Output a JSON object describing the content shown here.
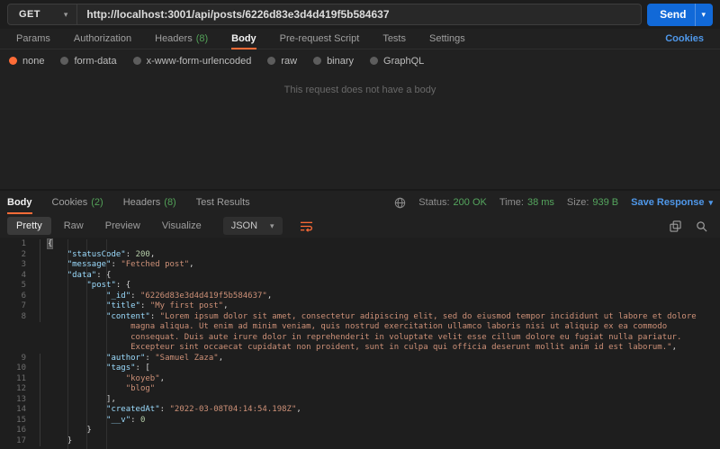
{
  "request": {
    "method": "GET",
    "url": "http://localhost:3001/api/posts/6226d83e3d4d419f5b584637",
    "send_label": "Send",
    "cookies_link": "Cookies",
    "tabs": [
      {
        "label": "Params"
      },
      {
        "label": "Authorization"
      },
      {
        "label": "Headers",
        "count": "(8)"
      },
      {
        "label": "Body",
        "active": true
      },
      {
        "label": "Pre-request Script"
      },
      {
        "label": "Tests"
      },
      {
        "label": "Settings"
      }
    ],
    "body_modes": [
      {
        "label": "none",
        "selected": true
      },
      {
        "label": "form-data"
      },
      {
        "label": "x-www-form-urlencoded"
      },
      {
        "label": "raw"
      },
      {
        "label": "binary"
      },
      {
        "label": "GraphQL"
      }
    ],
    "empty_body_message": "This request does not have a body"
  },
  "response": {
    "tabs": [
      {
        "label": "Body",
        "active": true
      },
      {
        "label": "Cookies",
        "count": "(2)"
      },
      {
        "label": "Headers",
        "count": "(8)"
      },
      {
        "label": "Test Results"
      }
    ],
    "meta": {
      "status_label": "Status:",
      "status_value": "200 OK",
      "time_label": "Time:",
      "time_value": "38 ms",
      "size_label": "Size:",
      "size_value": "939 B",
      "save_label": "Save Response"
    },
    "view_tabs": [
      {
        "label": "Pretty",
        "active": true
      },
      {
        "label": "Raw"
      },
      {
        "label": "Preview"
      },
      {
        "label": "Visualize"
      }
    ],
    "format": "JSON"
  },
  "colors": {
    "accent_orange": "#ff6c37",
    "send_blue": "#1169d8",
    "link_blue": "#4f98ea",
    "status_green": "#55a65e",
    "code_key": "#9cdcfe",
    "code_string": "#ce9178",
    "code_number": "#b5cea8"
  },
  "code": {
    "lines": [
      {
        "num": 1,
        "indent": 0,
        "segments": [
          {
            "type": "punct",
            "text": "{",
            "highlight": true
          }
        ]
      },
      {
        "num": 2,
        "indent": 1,
        "segments": [
          {
            "type": "key",
            "text": "\"statusCode\""
          },
          {
            "type": "punct",
            "text": ": "
          },
          {
            "type": "number",
            "text": "200"
          },
          {
            "type": "punct",
            "text": ","
          }
        ]
      },
      {
        "num": 3,
        "indent": 1,
        "segments": [
          {
            "type": "key",
            "text": "\"message\""
          },
          {
            "type": "punct",
            "text": ": "
          },
          {
            "type": "string",
            "text": "\"Fetched post\""
          },
          {
            "type": "punct",
            "text": ","
          }
        ]
      },
      {
        "num": 4,
        "indent": 1,
        "segments": [
          {
            "type": "key",
            "text": "\"data\""
          },
          {
            "type": "punct",
            "text": ": {"
          }
        ]
      },
      {
        "num": 5,
        "indent": 2,
        "segments": [
          {
            "type": "key",
            "text": "\"post\""
          },
          {
            "type": "punct",
            "text": ": {"
          }
        ]
      },
      {
        "num": 6,
        "indent": 3,
        "segments": [
          {
            "type": "key",
            "text": "\"_id\""
          },
          {
            "type": "punct",
            "text": ": "
          },
          {
            "type": "string",
            "text": "\"6226d83e3d4d419f5b584637\""
          },
          {
            "type": "punct",
            "text": ","
          }
        ]
      },
      {
        "num": 7,
        "indent": 3,
        "segments": [
          {
            "type": "key",
            "text": "\"title\""
          },
          {
            "type": "punct",
            "text": ": "
          },
          {
            "type": "string",
            "text": "\"My first post\""
          },
          {
            "type": "punct",
            "text": ","
          }
        ]
      },
      {
        "num": 8,
        "indent": 3,
        "segments": [
          {
            "type": "key",
            "text": "\"content\""
          },
          {
            "type": "punct",
            "text": ": "
          },
          {
            "type": "string",
            "text": "\"Lorem ipsum dolor sit amet, consectetur adipiscing elit, sed do eiusmod tempor incididunt ut labore et dolore magna aliqua. Ut enim ad minim veniam, quis nostrud exercitation ullamco laboris nisi ut aliquip ex ea commodo consequat. Duis aute irure dolor in reprehenderit in voluptate velit esse cillum dolore eu fugiat nulla pariatur. Excepteur sint occaecat cupidatat non proident, sunt in culpa qui officia deserunt mollit anim id est laborum.\""
          },
          {
            "type": "punct",
            "text": ","
          }
        ]
      },
      {
        "num": 9,
        "indent": 3,
        "segments": [
          {
            "type": "key",
            "text": "\"author\""
          },
          {
            "type": "punct",
            "text": ": "
          },
          {
            "type": "string",
            "text": "\"Samuel Zaza\""
          },
          {
            "type": "punct",
            "text": ","
          }
        ]
      },
      {
        "num": 10,
        "indent": 3,
        "segments": [
          {
            "type": "key",
            "text": "\"tags\""
          },
          {
            "type": "punct",
            "text": ": ["
          }
        ]
      },
      {
        "num": 11,
        "indent": 4,
        "segments": [
          {
            "type": "string",
            "text": "\"koyeb\""
          },
          {
            "type": "punct",
            "text": ","
          }
        ]
      },
      {
        "num": 12,
        "indent": 4,
        "segments": [
          {
            "type": "string",
            "text": "\"blog\""
          }
        ]
      },
      {
        "num": 13,
        "indent": 3,
        "segments": [
          {
            "type": "punct",
            "text": "],"
          }
        ]
      },
      {
        "num": 14,
        "indent": 3,
        "segments": [
          {
            "type": "key",
            "text": "\"createdAt\""
          },
          {
            "type": "punct",
            "text": ": "
          },
          {
            "type": "string",
            "text": "\"2022-03-08T04:14:54.198Z\""
          },
          {
            "type": "punct",
            "text": ","
          }
        ]
      },
      {
        "num": 15,
        "indent": 3,
        "segments": [
          {
            "type": "key",
            "text": "\"__v\""
          },
          {
            "type": "punct",
            "text": ": "
          },
          {
            "type": "number",
            "text": "0"
          }
        ]
      },
      {
        "num": 16,
        "indent": 2,
        "segments": [
          {
            "type": "punct",
            "text": "}"
          }
        ]
      },
      {
        "num": 17,
        "indent": 1,
        "segments": [
          {
            "type": "punct",
            "text": "}"
          }
        ]
      }
    ]
  }
}
